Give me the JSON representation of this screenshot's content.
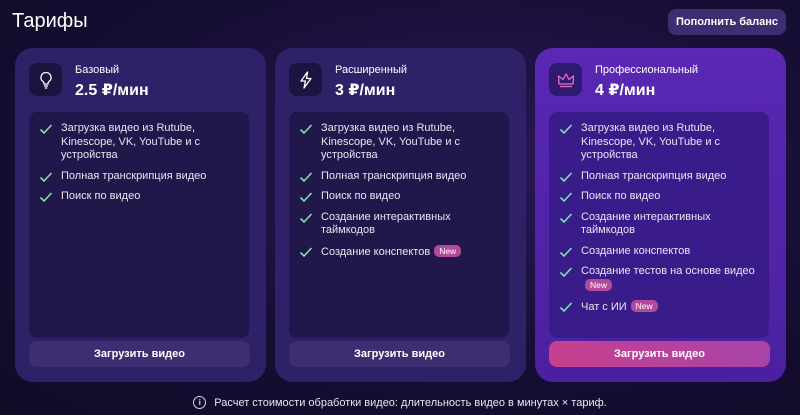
{
  "header": {
    "title": "Тарифы",
    "topup_label": "Пополнить баланс"
  },
  "plans": [
    {
      "name": "Базовый",
      "price": "2.5 ₽/мин",
      "icon": "lightbulb-icon",
      "features": [
        {
          "text": "Загрузка видео из Rutube, Kinescope, VK, YouTube и с устройства"
        },
        {
          "text": "Полная транскрипция видео"
        },
        {
          "text": "Поиск по видео"
        }
      ],
      "button": "Загрузить видео"
    },
    {
      "name": "Расширенный",
      "price": "3 ₽/мин",
      "icon": "lightning-icon",
      "features": [
        {
          "text": "Загрузка видео из Rutube, Kinescope, VK, YouTube и с устройства"
        },
        {
          "text": "Полная транскрипция видео"
        },
        {
          "text": "Поиск по видео"
        },
        {
          "text": "Создание интерактивных таймкодов"
        },
        {
          "text": "Создание конспектов",
          "badge": "New"
        }
      ],
      "button": "Загрузить видео"
    },
    {
      "name": "Профессиональный",
      "price": "4 ₽/мин",
      "icon": "crown-icon",
      "features": [
        {
          "text": "Загрузка видео из Rutube, Kinescope, VK, YouTube и с устройства"
        },
        {
          "text": "Полная транскрипция видео"
        },
        {
          "text": "Поиск по видео"
        },
        {
          "text": "Создание интерактивных таймкодов"
        },
        {
          "text": "Создание конспектов"
        },
        {
          "text": "Создание тестов на основе видео",
          "badge": "New"
        },
        {
          "text": "Чат с ИИ",
          "badge": "New"
        }
      ],
      "button": "Загрузить видео"
    }
  ],
  "footer": {
    "note": "Расчет стоимости обработки видео: длительность видео в минутах × тариф."
  },
  "colors": {
    "badge": "#b24a9c",
    "check": "#7ee0b0",
    "accent_button": "#c8408e"
  }
}
